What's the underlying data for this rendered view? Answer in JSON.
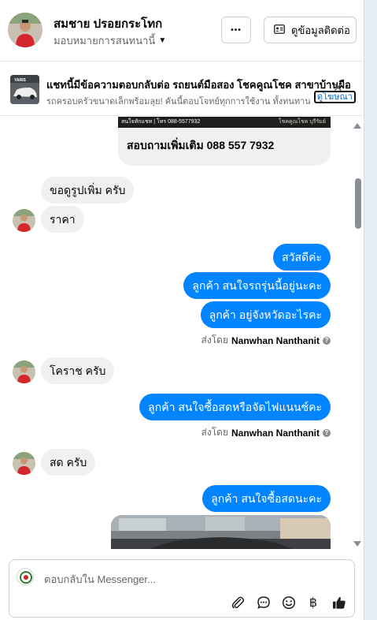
{
  "header": {
    "contact_name": "สมชาย ปรอยกระโทก",
    "assignment": "มอบหมายการสนทนานี้",
    "more_label": "•••",
    "view_contact_label": "ดูข้อมูลติดต่อ"
  },
  "ad": {
    "thumb_text": "YARIS",
    "title": "แชทนี้มีข้อความตอบกลับต่อ รถยนต์มือสอง โชคคูณโชค สาขาบ้านผือ",
    "description": "รถครอบครัวขนาดเล็กพร้อมลุย! คันนี้ตอบโจทย์ทุกการใช้งาน ทั้งทนทาน ใช้...",
    "link_label": "ดูโฆษณา",
    "close_label": "✕"
  },
  "thread": {
    "card": {
      "strip_left": "สนใจทักแชท | โทร 088-5577932",
      "strip_right": "โชคคูณโชค บุรีรัมย์",
      "phone_text": "สอบถามเพิ่มเติม 088 557 7932"
    },
    "messages": [
      {
        "dir": "in",
        "text": "ขอดูรูปเพิ่ม ครับ"
      },
      {
        "dir": "in",
        "text": "ราคา"
      },
      {
        "dir": "out",
        "text": "สวัสดีค่ะ"
      },
      {
        "dir": "out",
        "text": "ลูกค้า สนใจรถรุ่นนี้อยู่นะคะ"
      },
      {
        "dir": "out",
        "text": "ลูกค้า อยู่จังหวัดอะไรคะ"
      },
      {
        "dir": "in",
        "text": "โคราช ครับ"
      },
      {
        "dir": "out",
        "text": "ลูกค้า สนใจซื้อสดหรือจัดไฟแนนซ์คะ"
      },
      {
        "dir": "in",
        "text": "สด ครับ"
      },
      {
        "dir": "out",
        "text": "ลูกค้า สนใจซื้อสดนะคะ"
      }
    ],
    "sent_by_prefix": "ส่งโดย",
    "sent_by_name": "Nanwhan Nanthanit"
  },
  "composer": {
    "placeholder": "ตอบกลับใน Messenger...",
    "tools": [
      "paperclip-icon",
      "chat-bubble-icon",
      "smiley-icon",
      "baht-icon",
      "thumbs-up-icon"
    ],
    "baht_symbol": "฿"
  },
  "colors": {
    "outgoing_bubble": "#0084ff",
    "incoming_bubble": "#f0f0f0",
    "link": "#0a66c2"
  }
}
